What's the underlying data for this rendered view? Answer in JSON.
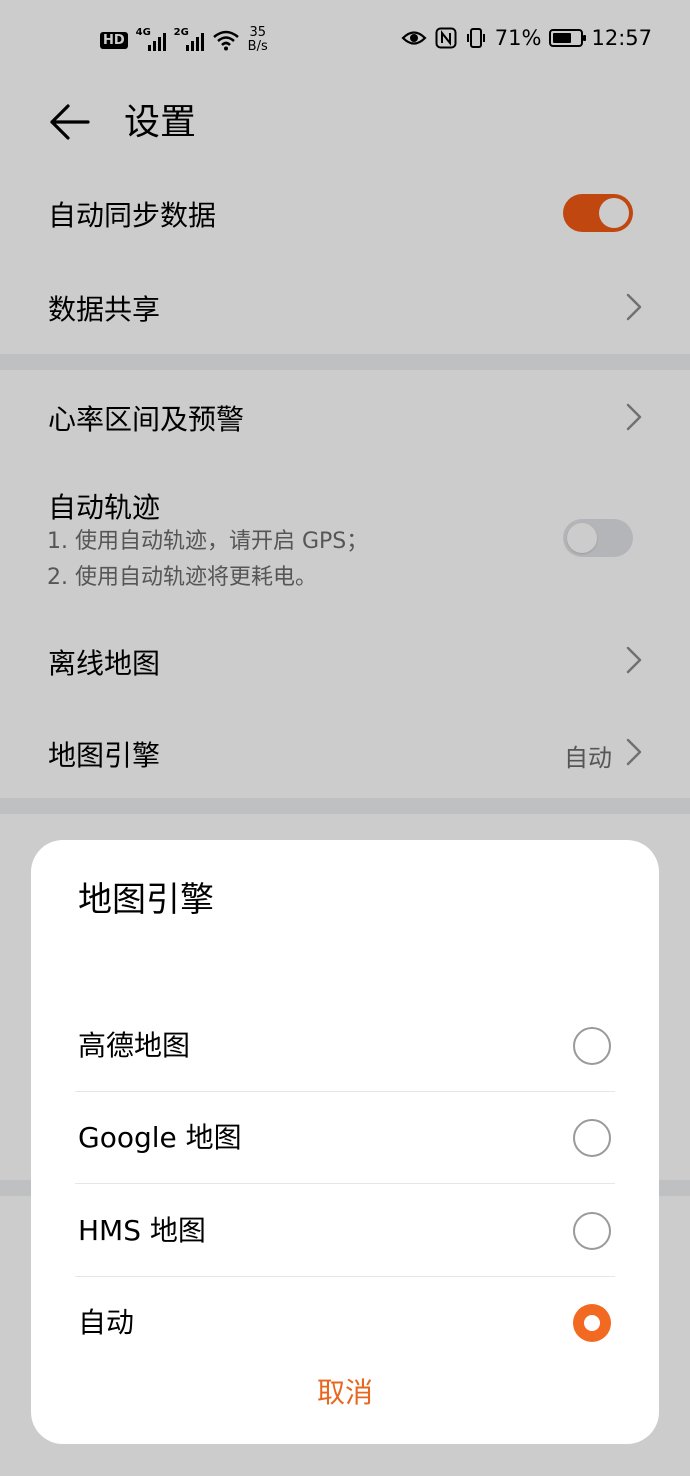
{
  "status_bar": {
    "hd": "HD",
    "sim1_network": "4G",
    "sim2_network": "2G",
    "net_speed_value": "35",
    "net_speed_unit": "B/s",
    "battery_text": "71%",
    "battery_level": 0.71,
    "time": "12:57"
  },
  "header": {
    "title": "设置"
  },
  "settings": {
    "auto_sync": {
      "label": "自动同步数据",
      "enabled": true
    },
    "data_sharing": {
      "label": "数据共享"
    },
    "heart_rate": {
      "label": "心率区间及预警"
    },
    "auto_track": {
      "label": "自动轨迹",
      "desc_line1": "1. 使用自动轨迹，请开启 GPS；",
      "desc_line2": "2. 使用自动轨迹将更耗电。",
      "enabled": false
    },
    "offline_map": {
      "label": "离线地图"
    },
    "map_engine": {
      "label": "地图引擎",
      "value": "自动"
    }
  },
  "dialog": {
    "title": "地图引擎",
    "options": [
      {
        "label": "高德地图",
        "selected": false
      },
      {
        "label": "Google 地图",
        "selected": false
      },
      {
        "label": "HMS 地图",
        "selected": false
      },
      {
        "label": "自动",
        "selected": true
      }
    ],
    "cancel_label": "取消"
  },
  "colors": {
    "accent": "#f05a14",
    "cancel_text": "#e8661f",
    "secondary_text": "#6c6c6c"
  }
}
